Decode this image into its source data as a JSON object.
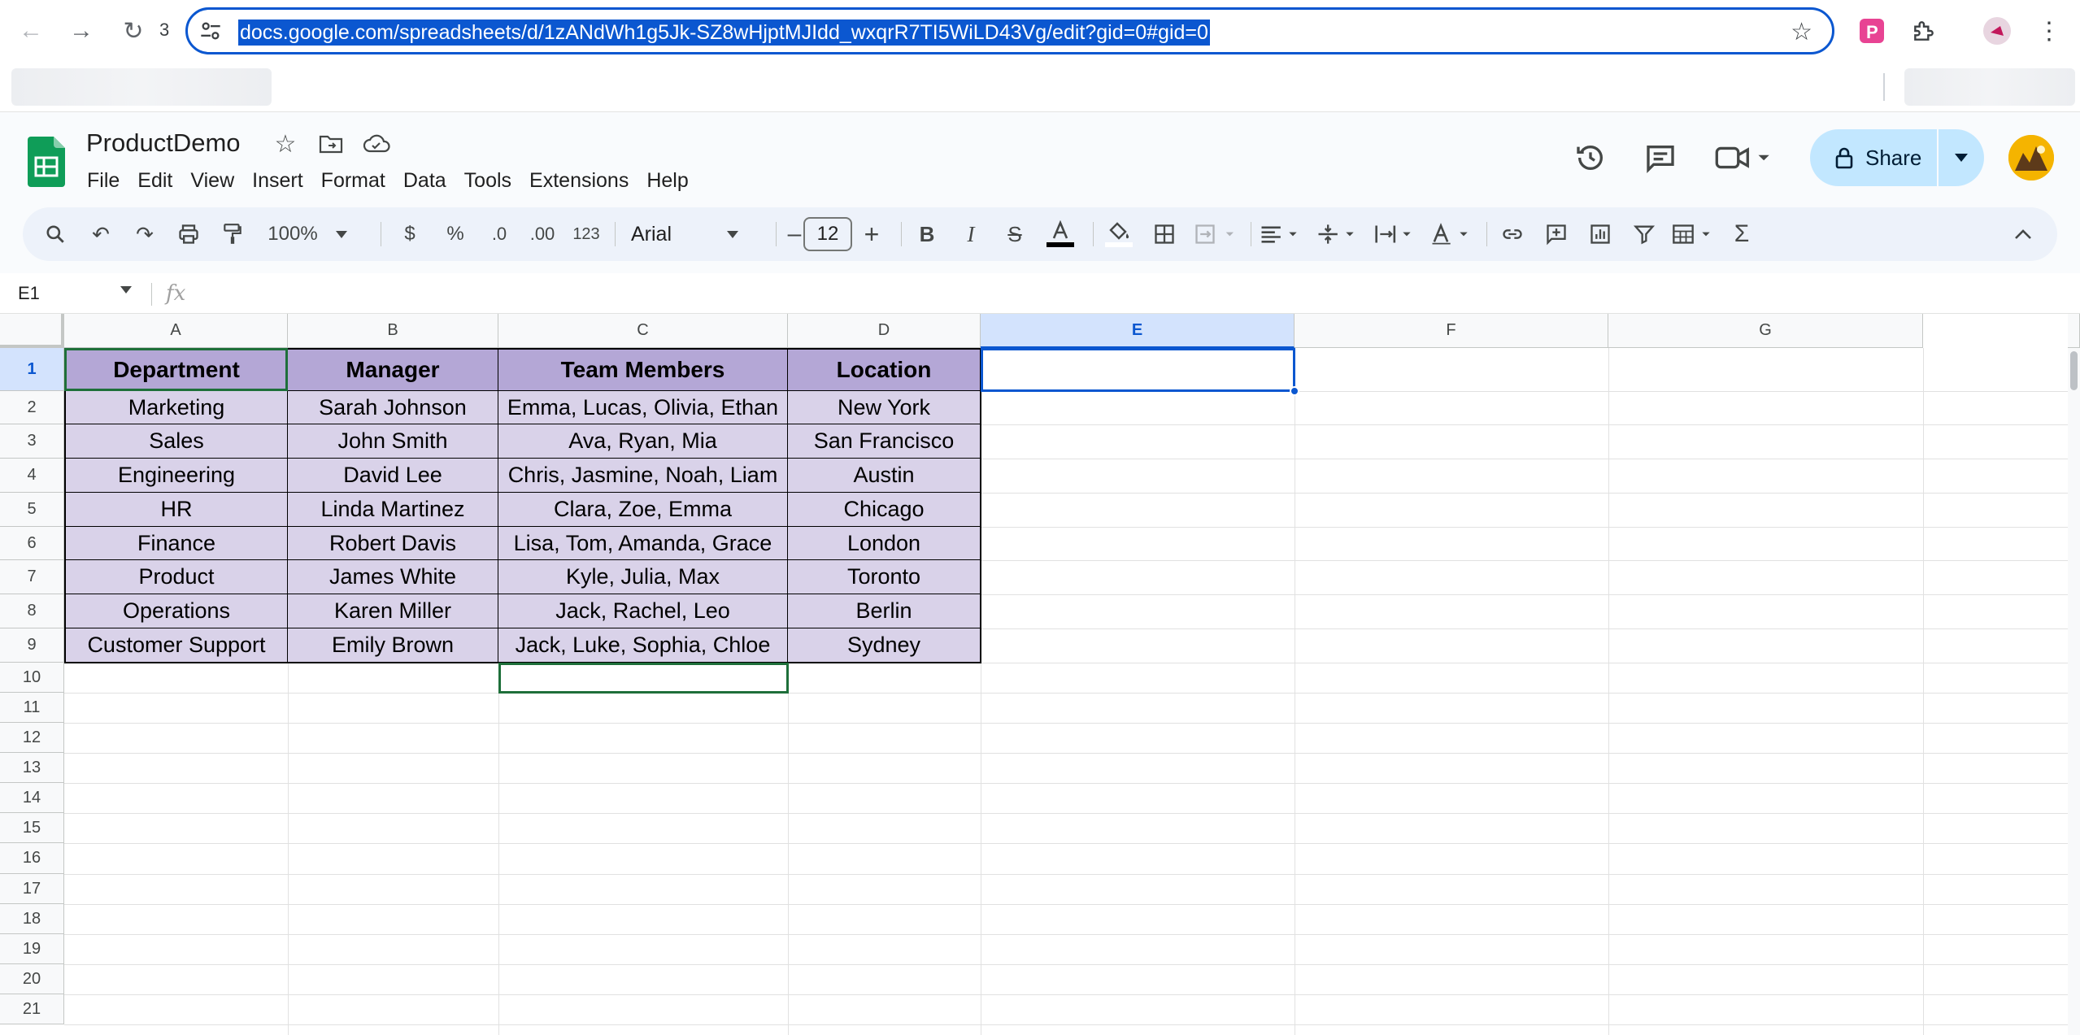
{
  "browser": {
    "tab_count": "3",
    "url": "docs.google.com/spreadsheets/d/1zANdWh1g5Jk-SZ8wHjptMJIdd_wxqrR7TI5WiLD43Vg/edit?gid=0#gid=0"
  },
  "doc": {
    "title": "ProductDemo",
    "menus": [
      "File",
      "Edit",
      "View",
      "Insert",
      "Format",
      "Data",
      "Tools",
      "Extensions",
      "Help"
    ],
    "share_label": "Share"
  },
  "toolbar": {
    "zoom": "100%",
    "currency": "$",
    "percent": "%",
    "decrease_decimal": ".0",
    "increase_decimal": ".00",
    "number_format": "123",
    "font": "Arial",
    "font_size": "12"
  },
  "formula_bar": {
    "name_box": "E1",
    "fx_label": "fx",
    "formula": ""
  },
  "columns": [
    "A",
    "B",
    "C",
    "D",
    "E",
    "F",
    "G"
  ],
  "rows": [
    "1",
    "2",
    "3",
    "4",
    "5",
    "6",
    "7",
    "8",
    "9",
    "10",
    "11",
    "12",
    "13",
    "14",
    "15",
    "16",
    "17",
    "18",
    "19",
    "20",
    "21"
  ],
  "selected_cell": "E1",
  "table": {
    "headers": [
      "Department",
      "Manager",
      "Team Members",
      "Location"
    ],
    "rows": [
      [
        "Marketing",
        "Sarah Johnson",
        "Emma, Lucas, Olivia, Ethan",
        "New York"
      ],
      [
        "Sales",
        "John Smith",
        "Ava, Ryan, Mia",
        "San Francisco"
      ],
      [
        "Engineering",
        "David Lee",
        "Chris, Jasmine, Noah, Liam",
        "Austin"
      ],
      [
        "HR",
        "Linda Martinez",
        "Clara, Zoe, Emma",
        "Chicago"
      ],
      [
        "Finance",
        "Robert Davis",
        "Lisa, Tom, Amanda, Grace",
        "London"
      ],
      [
        "Product",
        "James White",
        "Kyle, Julia, Max",
        "Toronto"
      ],
      [
        "Operations",
        "Karen Miller",
        "Jack, Rachel, Leo",
        "Berlin"
      ],
      [
        "Customer Support",
        "Emily Brown",
        "Jack, Luke, Sophia, Chloe",
        "Sydney"
      ]
    ]
  },
  "colors": {
    "header_fill": "#b4a7d6",
    "cell_fill": "#d9d2e9",
    "selection": "#0b57d0",
    "share_bg": "#c2e7ff"
  },
  "icons": {
    "back": "arrow-left-icon",
    "forward": "arrow-right-icon",
    "reload": "reload-icon",
    "search": "search-icon",
    "undo": "undo-icon",
    "redo": "redo-icon",
    "print": "print-icon",
    "paint_format": "paint-format-icon",
    "bold": "bold-icon",
    "italic": "italic-icon",
    "strikethrough": "strikethrough-icon",
    "text_color": "text-color-icon",
    "fill_color": "fill-color-icon",
    "borders": "borders-icon",
    "merge": "merge-cells-icon",
    "align": "align-icon",
    "valign": "vertical-align-icon",
    "wrap": "text-wrap-icon",
    "rotate": "text-rotate-icon",
    "link": "link-icon",
    "comment": "add-comment-icon",
    "chart": "insert-chart-icon",
    "filter": "filter-icon",
    "filter_views": "filter-views-icon",
    "functions": "functions-icon",
    "history": "history-icon",
    "comments": "comments-icon",
    "meet": "meet-icon"
  }
}
